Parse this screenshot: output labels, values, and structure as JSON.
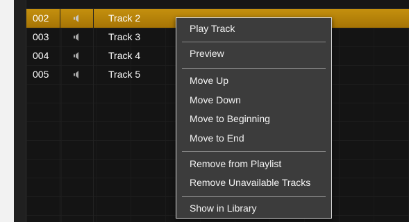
{
  "tracks": [
    {
      "number": "002",
      "title": "Track 2",
      "selected": true
    },
    {
      "number": "003",
      "title": "Track 3",
      "selected": false
    },
    {
      "number": "004",
      "title": "Track 4",
      "selected": false
    },
    {
      "number": "005",
      "title": "Track 5",
      "selected": false
    }
  ],
  "context_menu": {
    "items": [
      "Play Track",
      "Preview",
      "Move Up",
      "Move Down",
      "Move to Beginning",
      "Move to End",
      "Remove from Playlist",
      "Remove Unavailable Tracks",
      "Show in Library"
    ]
  },
  "colors": {
    "selected_row": "#b8860b",
    "menu_background": "#3c3c3c",
    "list_background": "#141414"
  },
  "icons": {
    "track_status": "speaker-icon"
  }
}
